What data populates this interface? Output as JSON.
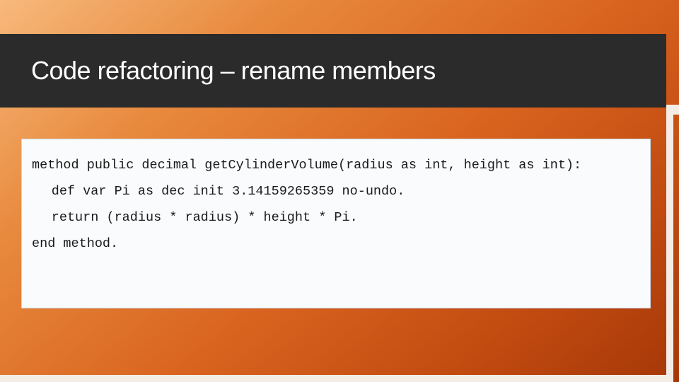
{
  "title": "Code refactoring – rename members",
  "code": {
    "line1": "method public decimal getCylinderVolume(radius as int, height as int):",
    "line2": "def var Pi as dec init 3.14159265359 no-undo.",
    "line3": "return (radius * radius) * height * Pi.",
    "line4": "end method."
  }
}
